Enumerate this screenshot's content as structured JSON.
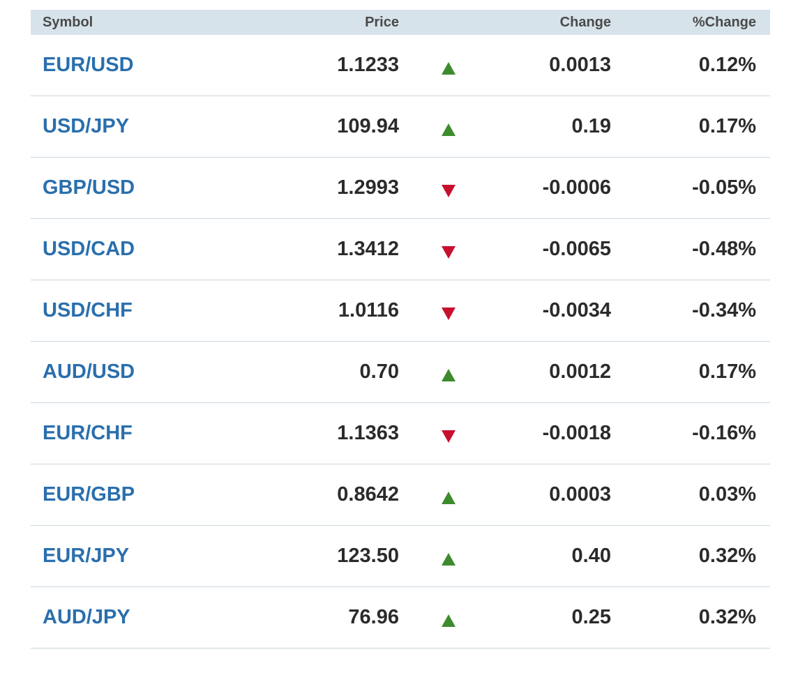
{
  "columns": {
    "symbol": "Symbol",
    "price": "Price",
    "change": "Change",
    "pct_change": "%Change"
  },
  "colors": {
    "header_bg": "#d7e3ea",
    "symbol_link": "#2a6fad",
    "up": "#3d8b2d",
    "down": "#c8102e",
    "divider": "#c9d6de"
  },
  "rows": [
    {
      "symbol": "EUR/USD",
      "price": "1.1233",
      "direction": "up",
      "change": "0.0013",
      "pct": "0.12%"
    },
    {
      "symbol": "USD/JPY",
      "price": "109.94",
      "direction": "up",
      "change": "0.19",
      "pct": "0.17%"
    },
    {
      "symbol": "GBP/USD",
      "price": "1.2993",
      "direction": "down",
      "change": "-0.0006",
      "pct": "-0.05%"
    },
    {
      "symbol": "USD/CAD",
      "price": "1.3412",
      "direction": "down",
      "change": "-0.0065",
      "pct": "-0.48%"
    },
    {
      "symbol": "USD/CHF",
      "price": "1.0116",
      "direction": "down",
      "change": "-0.0034",
      "pct": "-0.34%"
    },
    {
      "symbol": "AUD/USD",
      "price": "0.70",
      "direction": "up",
      "change": "0.0012",
      "pct": "0.17%"
    },
    {
      "symbol": "EUR/CHF",
      "price": "1.1363",
      "direction": "down",
      "change": "-0.0018",
      "pct": "-0.16%"
    },
    {
      "symbol": "EUR/GBP",
      "price": "0.8642",
      "direction": "up",
      "change": "0.0003",
      "pct": "0.03%"
    },
    {
      "symbol": "EUR/JPY",
      "price": "123.50",
      "direction": "up",
      "change": "0.40",
      "pct": "0.32%"
    },
    {
      "symbol": "AUD/JPY",
      "price": "76.96",
      "direction": "up",
      "change": "0.25",
      "pct": "0.32%"
    }
  ]
}
